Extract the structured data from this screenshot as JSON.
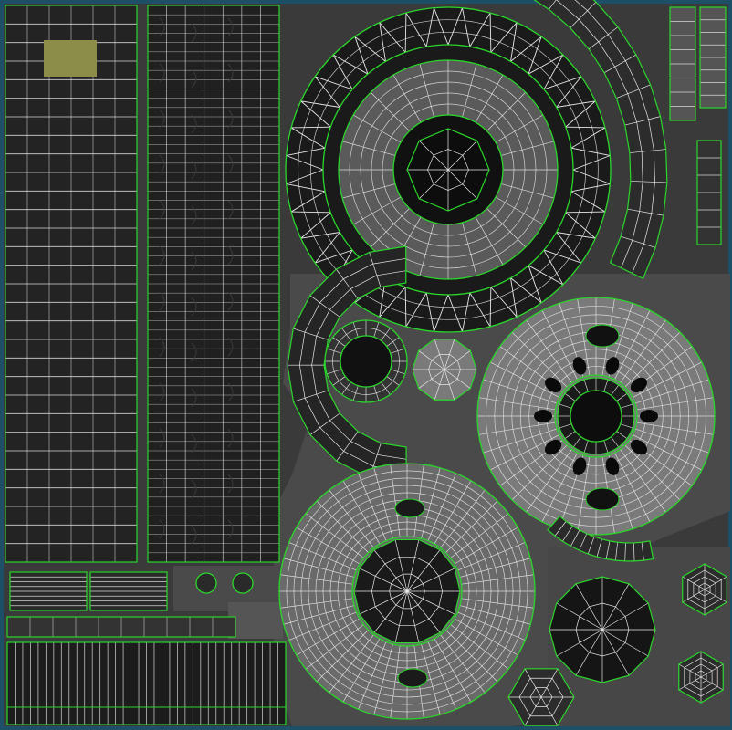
{
  "uv_map": {
    "colors": {
      "frame": "#1d4f66",
      "background": "#3a3a3a",
      "seam": "#2bd62b",
      "wire": "#e8e8e8",
      "highlight_patch": "#8d8d4a",
      "dark_fill": "#1e1e1e",
      "mid_fill": "#4a4a4a",
      "light_fill": "#6a6a6a"
    }
  }
}
